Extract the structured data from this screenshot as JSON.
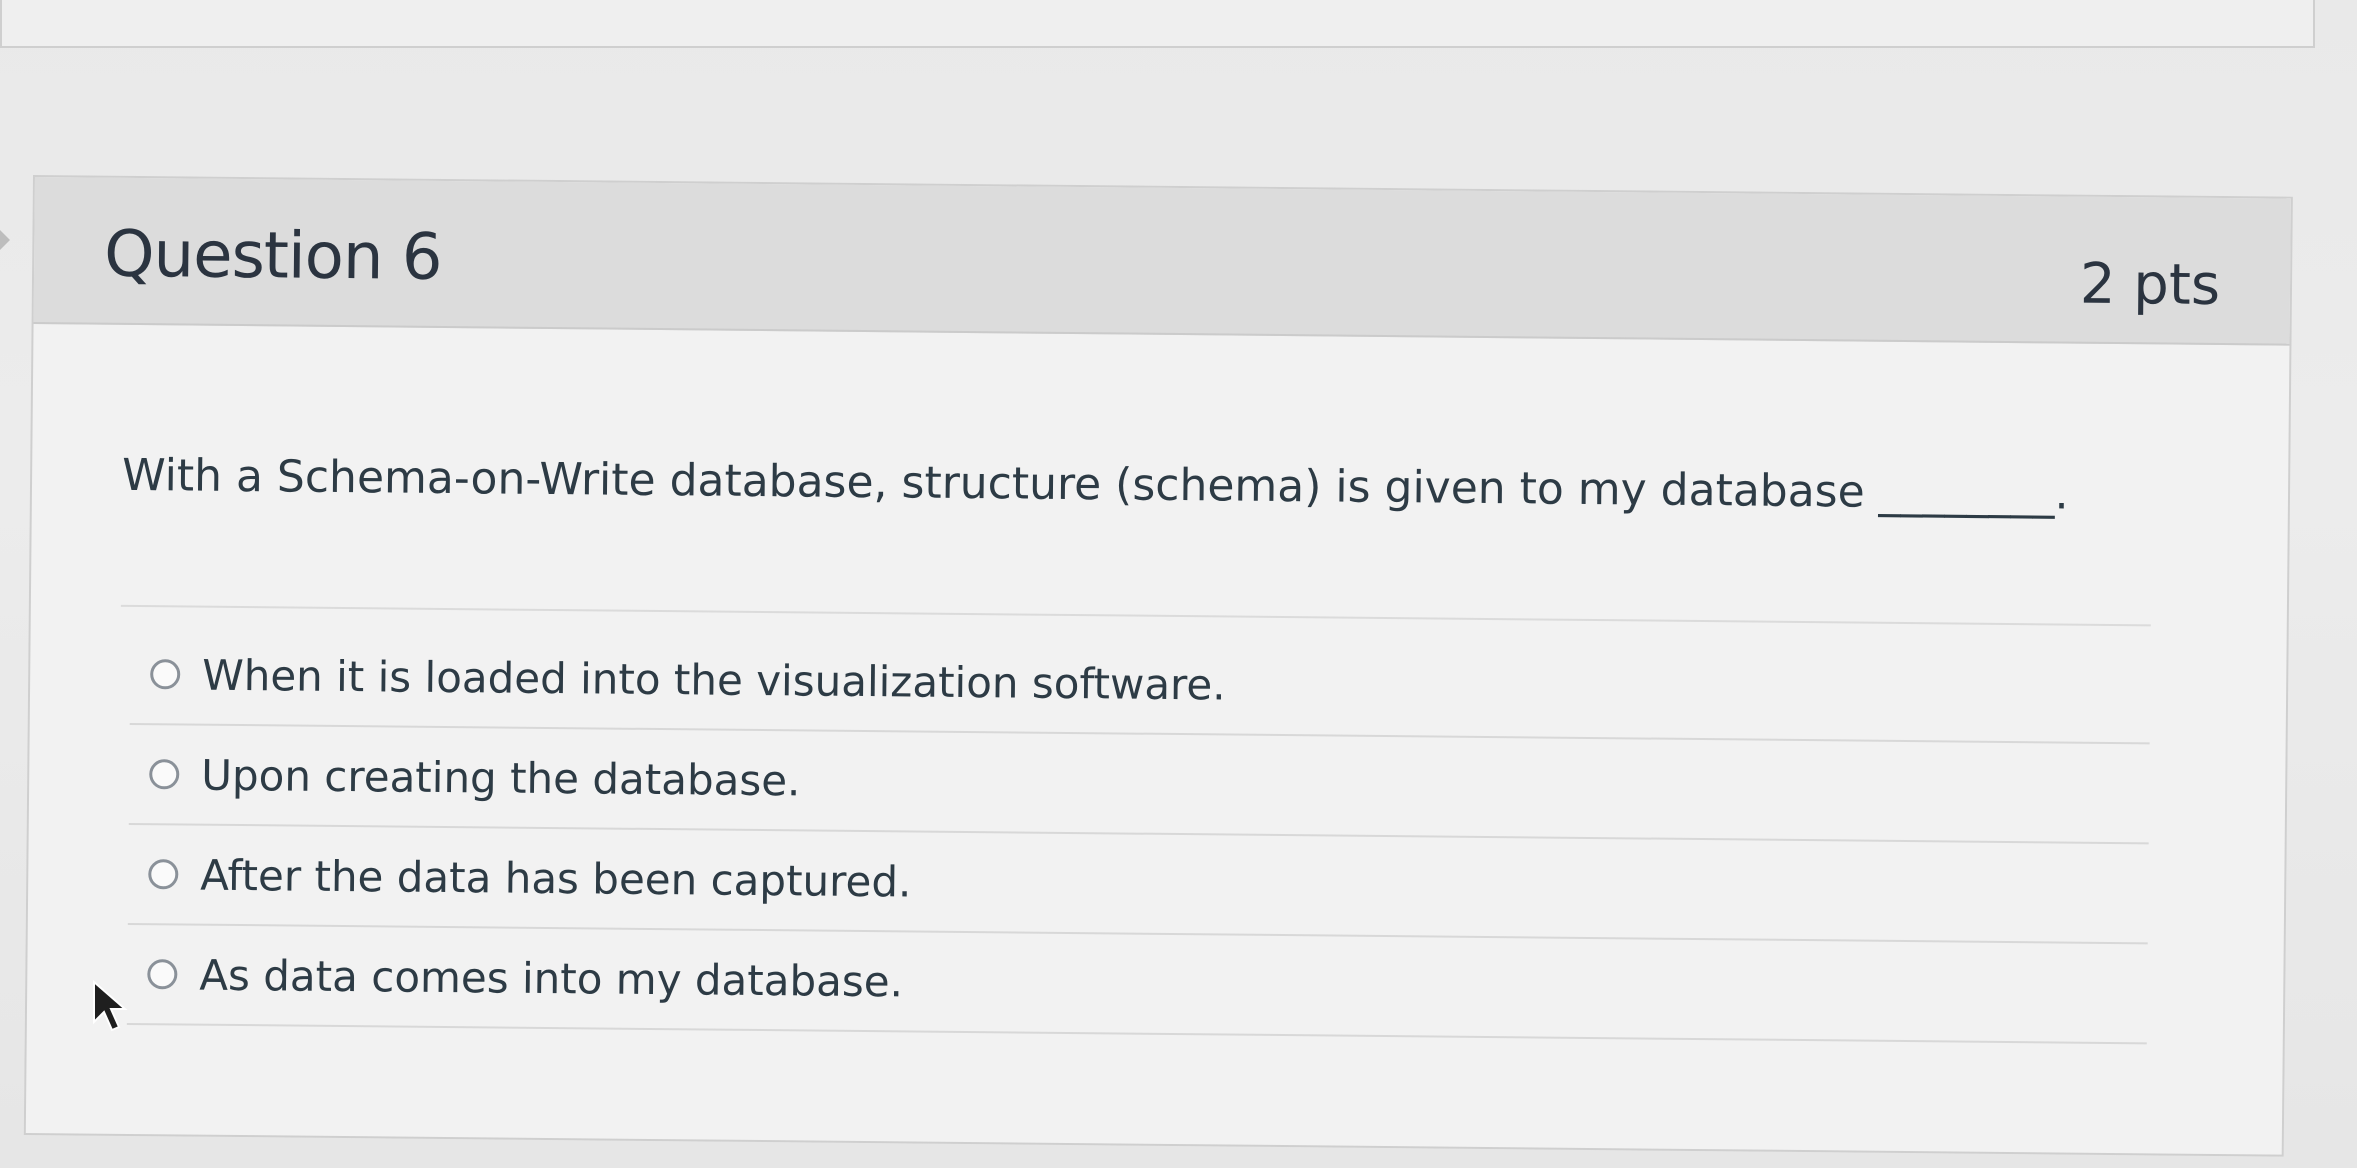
{
  "question": {
    "title": "Question 6",
    "points": "2 pts",
    "text": "With a Schema-on-Write database, structure (schema) is given to my database ________."
  },
  "answers": [
    {
      "label": "When it is loaded into the visualization software."
    },
    {
      "label": "Upon creating the database."
    },
    {
      "label": "After the data has been captured."
    },
    {
      "label": "As data comes into my database."
    }
  ],
  "icons": {
    "answer_radio": "radio-unselected-icon",
    "pointer": "mouse-pointer-icon"
  },
  "colors": {
    "header_bg": "#dcdcdc",
    "card_bg": "#f2f2f2",
    "text": "#2d3b45",
    "radio_border": "#8a9199"
  }
}
